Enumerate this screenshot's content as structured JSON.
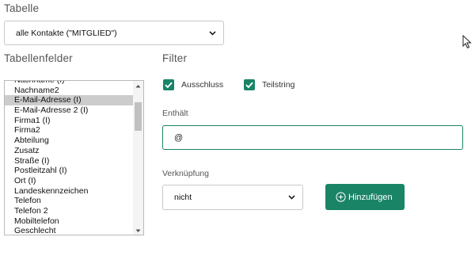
{
  "table": {
    "label": "Tabelle",
    "selected": "alle Kontakte (\"MITGLIED\")"
  },
  "fields": {
    "label": "Tabellenfelder",
    "items": [
      "Nachname (I)",
      "Nachname2",
      "E-Mail-Adresse (I)",
      "E-Mail-Adresse 2 (I)",
      "Firma1 (I)",
      "Firma2",
      "Abteilung",
      "Zusatz",
      "Straße (I)",
      "Postleitzahl (I)",
      "Ort (I)",
      "Landeskennzeichen",
      "Telefon",
      "Telefon 2",
      "Mobiltelefon",
      "Geschlecht"
    ],
    "selected_item": "E-Mail-Adresse (I)"
  },
  "filter": {
    "label": "Filter",
    "ausschluss_label": "Ausschluss",
    "ausschluss_checked": true,
    "teilstring_label": "Teilstring",
    "teilstring_checked": true,
    "contains_label": "Enthält",
    "contains_value": "@",
    "link_label": "Verknüpfung",
    "link_selected": "nicht",
    "add_label": "Hinzufügen"
  },
  "colors": {
    "accent": "#1a8467",
    "selected_row": "#cccccc"
  }
}
